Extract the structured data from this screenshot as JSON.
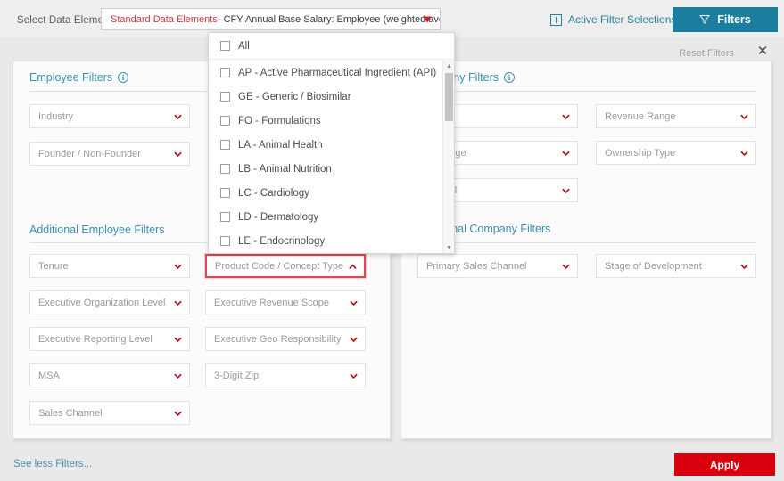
{
  "colors": {
    "filters_button": "#1b7e9e",
    "apply_button": "#d9000d",
    "section_title": "#3e8fb0",
    "chevron": "#b3131f",
    "highlight_border": "#e0484f",
    "link": "#4e8fb5"
  },
  "topbar": {
    "select_label": "Select Data Element",
    "data_element_prefix": "Standard Data Elements",
    "data_element_rest": " - CFY Annual Base Salary: Employee (weighted average)",
    "active_filter_selections": "Active Filter Selections",
    "filters_button": "Filters",
    "plus_icon": "plus-box-icon",
    "funnel_icon": "funnel-icon",
    "caret_icon": "caret-down-icon"
  },
  "subheader": {
    "reset_filters": "Reset Filters",
    "close_icon": "close-icon",
    "close_glyph": "✕"
  },
  "left_panel": {
    "employee_filters": {
      "title": "Employee Filters",
      "info_icon": "info-icon",
      "info_glyph": "i",
      "fields": [
        {
          "label": "Industry"
        },
        {
          "label": "Founder / Non-Founder"
        }
      ]
    },
    "additional_employee_filters": {
      "title": "Additional Employee Filters",
      "column_one": [
        {
          "label": "Tenure"
        },
        {
          "label": "Executive Organization Level"
        },
        {
          "label": "Executive Reporting Level"
        },
        {
          "label": "MSA"
        },
        {
          "label": "Sales Channel"
        }
      ],
      "column_two": [
        {
          "label": "Product Code / Concept Type",
          "highlighted": true,
          "expanded": true
        },
        {
          "label": "Executive Revenue Scope"
        },
        {
          "label": "Executive Geo Responsibility"
        },
        {
          "label": "3-Digit Zip"
        }
      ]
    }
  },
  "right_panel": {
    "company_filters": {
      "title": "Company Filters",
      "info_icon": "info-icon",
      "info_glyph": "i",
      "column_one": [
        {
          "label": "",
          "occluded": true
        },
        {
          "label": "nt Range",
          "occluded": true
        },
        {
          "label": " Capital",
          "occluded": true
        }
      ],
      "column_two": [
        {
          "label": "Revenue Range"
        },
        {
          "label": "Ownership Type"
        }
      ]
    },
    "additional_company_filters": {
      "title": "Additional Company Filters",
      "fields": [
        {
          "label": "Primary Sales Channel"
        },
        {
          "label": "Stage of Development"
        }
      ]
    }
  },
  "dropdown": {
    "all_label": "All",
    "items": [
      {
        "label": "AP - Active Pharmaceutical Ingredient (API)"
      },
      {
        "label": "GE - Generic / Biosimilar"
      },
      {
        "label": "FO - Formulations"
      },
      {
        "label": "LA - Animal Health"
      },
      {
        "label": "LB - Animal Nutrition"
      },
      {
        "label": "LC - Cardiology"
      },
      {
        "label": "LD - Dermatology"
      },
      {
        "label": "LE - Endocrinology"
      }
    ],
    "scroll_up_glyph": "▲",
    "scroll_down_glyph": "▼"
  },
  "footer": {
    "see_less": "See less Filters...",
    "apply": "Apply"
  }
}
